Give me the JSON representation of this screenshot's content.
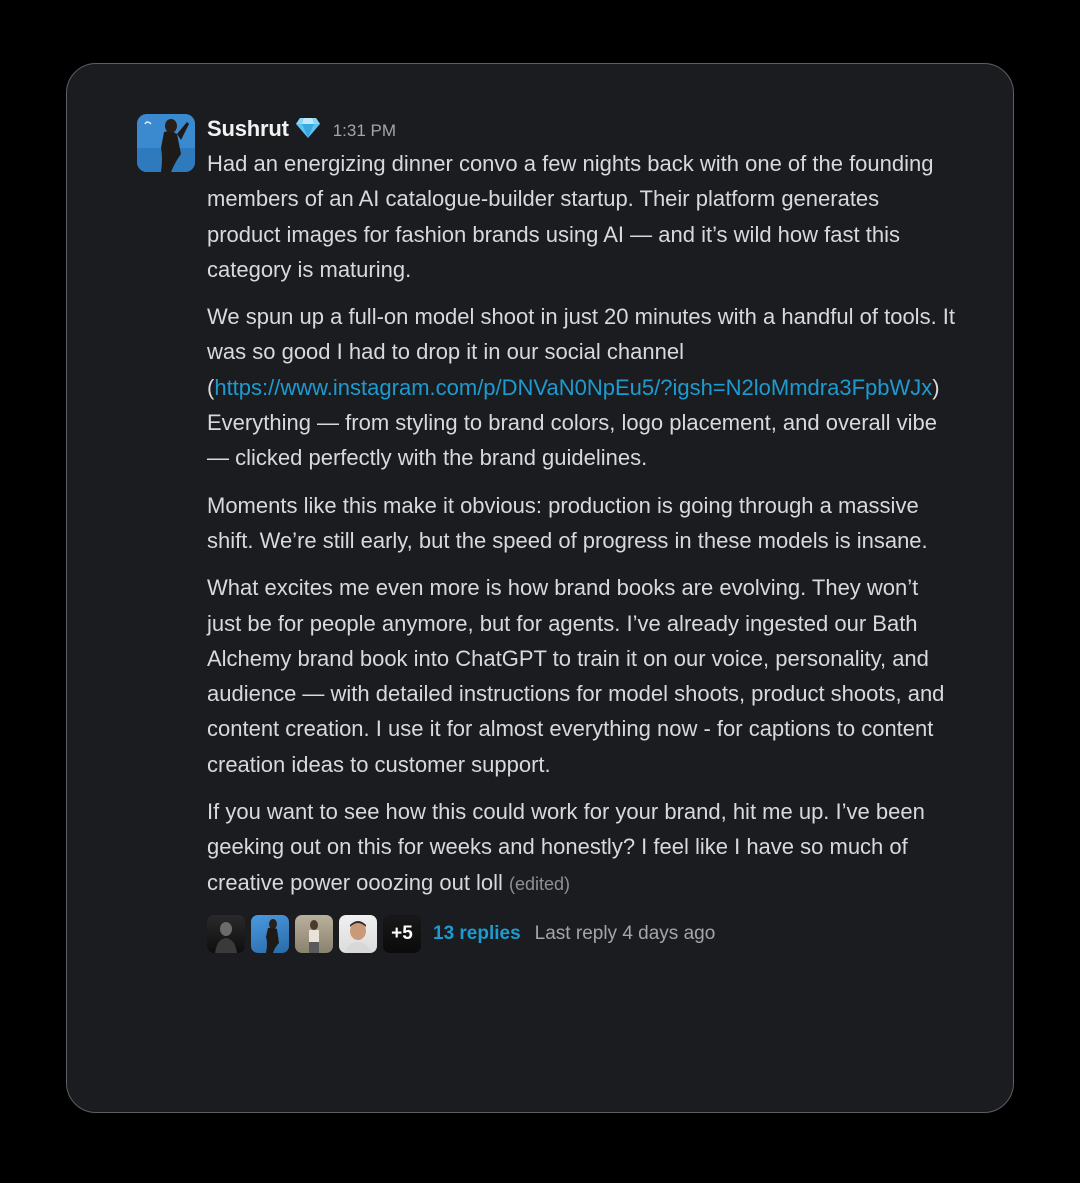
{
  "message": {
    "author": "Sushrut",
    "badge_icon": "gem-icon",
    "timestamp": "1:31 PM",
    "paragraphs": {
      "p1": "Had an energizing dinner convo a few nights back with one of the founding members of an AI catalogue-builder startup. Their platform generates product images for fashion brands using AI — and it’s wild how fast this category is maturing.",
      "p2_before": "We spun up a full-on model shoot in just 20 minutes with a handful of tools. It was so good I had to drop it in our social channel (",
      "p2_link": "https://www.instagram.com/p/DNVaN0NpEu5/?igsh=N2loMmdra3FpbWJx",
      "p2_after": ") Everything — from styling to brand colors, logo placement, and overall vibe — clicked perfectly with the brand guidelines.",
      "p3": "Moments like this make it obvious: production is going through a massive shift. We’re still early, but the speed of progress in these models is insane.",
      "p4": "What excites me even more is how brand books are evolving. They won’t just be for people anymore, but for agents. I’ve already ingested our Bath Alchemy brand book into ChatGPT to train it on our voice, personality, and audience — with detailed instructions for model shoots, product shoots, and content creation. I use it for almost everything now - for captions to content creation ideas to customer support.",
      "p5": "If you want to see how this could work for your brand, hit me up. I’ve been geeking out on this for weeks and honestly? I feel like I have so much of creative power ooozing out loll"
    },
    "edited_label": "(edited)"
  },
  "thread": {
    "more_count": "+5",
    "replies_label": "13 replies",
    "last_reply": "Last reply 4 days ago"
  },
  "colors": {
    "background": "#000000",
    "card": "#1b1c1f",
    "link": "#1d9bd1",
    "text": "#d9d9dc"
  }
}
